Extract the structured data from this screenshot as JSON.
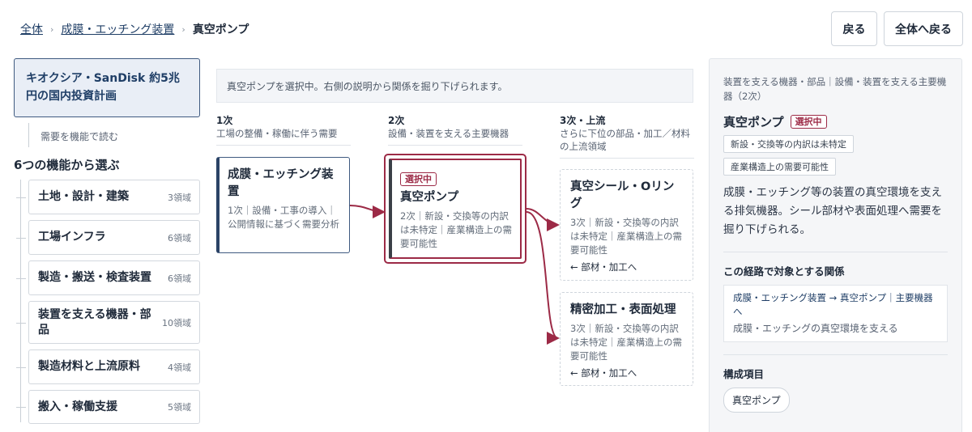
{
  "breadcrumb": {
    "root": "全体",
    "parent": "成膜・エッチング装置",
    "current": "真空ポンプ",
    "separator": "›"
  },
  "header": {
    "back_label": "戻る",
    "home_label": "全体へ戻る"
  },
  "sidebar": {
    "project_title": "キオクシア・SanDisk 約5兆円の国内投資計画",
    "read_by_function": "需要を機能で読む",
    "section_title": "6つの機能から選ぶ",
    "items": [
      {
        "label": "土地・設計・建築",
        "count": "3領域"
      },
      {
        "label": "工場インフラ",
        "count": "6領域"
      },
      {
        "label": "製造・搬送・検査装置",
        "count": "6領域"
      },
      {
        "label": "装置を支える機器・部品",
        "count": "10領域"
      },
      {
        "label": "製造材料と上流原料",
        "count": "4領域"
      },
      {
        "label": "搬入・稼働支援",
        "count": "5領域"
      }
    ]
  },
  "main": {
    "notice": "真空ポンプを選択中。右側の説明から関係を掘り下げられます。",
    "columns": [
      {
        "level": "1次",
        "sub": "工場の整備・稼働に伴う需要"
      },
      {
        "level": "2次",
        "sub": "設備・装置を支える主要機器"
      },
      {
        "level": "3次・上流",
        "sub": "さらに下位の部品・加工／材料の上流領域"
      }
    ],
    "parent_node": {
      "title": "成膜・エッチング装置",
      "desc": "1次｜設備・工事の導入｜公開情報に基づく需要分析"
    },
    "selected_node": {
      "badge": "選択中",
      "title": "真空ポンプ",
      "desc": "2次｜新設・交換等の内訳は未特定｜産業構造上の需要可能性"
    },
    "children": [
      {
        "title": "真空シール・Oリング",
        "desc": "3次｜新設・交換等の内訳は未特定｜産業構造上の需要可能性",
        "link": "← 部材・加工へ"
      },
      {
        "title": "精密加工・表面処理",
        "desc": "3次｜新設・交換等の内訳は未特定｜産業構造上の需要可能性",
        "link": "← 部材・加工へ"
      }
    ],
    "colors": {
      "accent": "#9c2a46",
      "navy": "#2b4366"
    }
  },
  "detail": {
    "category": "装置を支える機器・部品｜設備・装置を支える主要機器（2次）",
    "title": "真空ポンプ",
    "badge": "選択中",
    "tags": [
      "新設・交換等の内訳は未特定",
      "産業構造上の需要可能性"
    ],
    "body": "成膜・エッチング等の装置の真空環境を支える排気機器。シール部材や表面処理へ需要を掘り下げられる。",
    "relation_heading": "この経路で対象とする関係",
    "relation_link": "成膜・エッチング装置 → 真空ポンプ｜主要機器へ",
    "relation_desc": "成膜・エッチングの真空環境を支える",
    "components_heading": "構成項目",
    "component_chip": "真空ポンプ"
  }
}
